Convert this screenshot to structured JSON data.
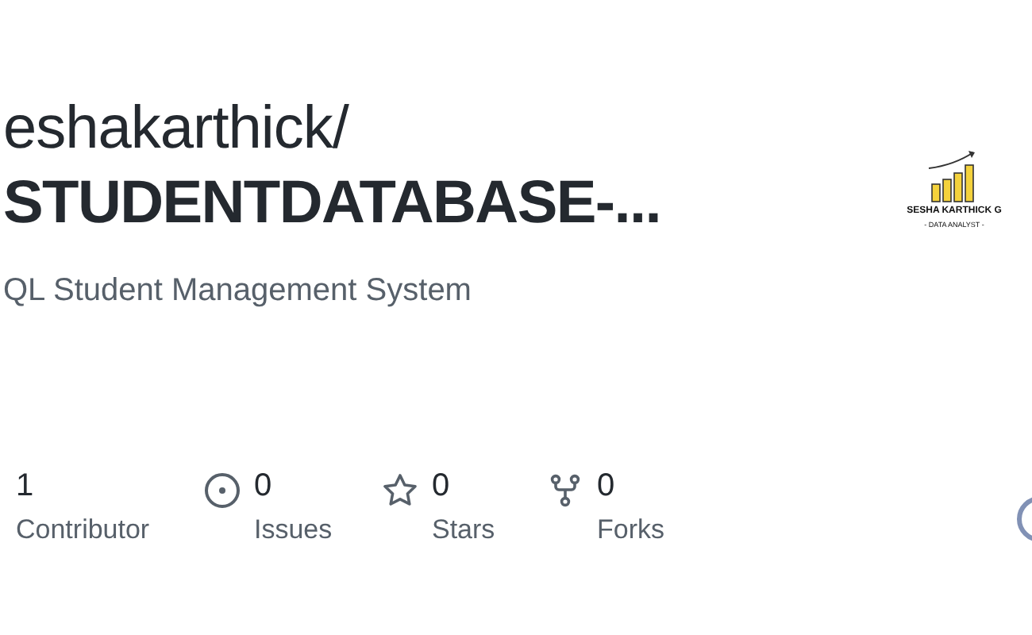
{
  "repo": {
    "owner": "eshakarthick/",
    "name": "STUDENTDATABASE-...",
    "description": "QL Student Management System"
  },
  "logo": {
    "name": "SESHA KARTHICK G",
    "role": "- DATA ANALYST -"
  },
  "stats": [
    {
      "kind": "contributors",
      "value": "1",
      "label": "Contributor"
    },
    {
      "kind": "issues",
      "value": "0",
      "label": "Issues"
    },
    {
      "kind": "stars",
      "value": "0",
      "label": "Stars"
    },
    {
      "kind": "forks",
      "value": "0",
      "label": "Forks"
    }
  ]
}
